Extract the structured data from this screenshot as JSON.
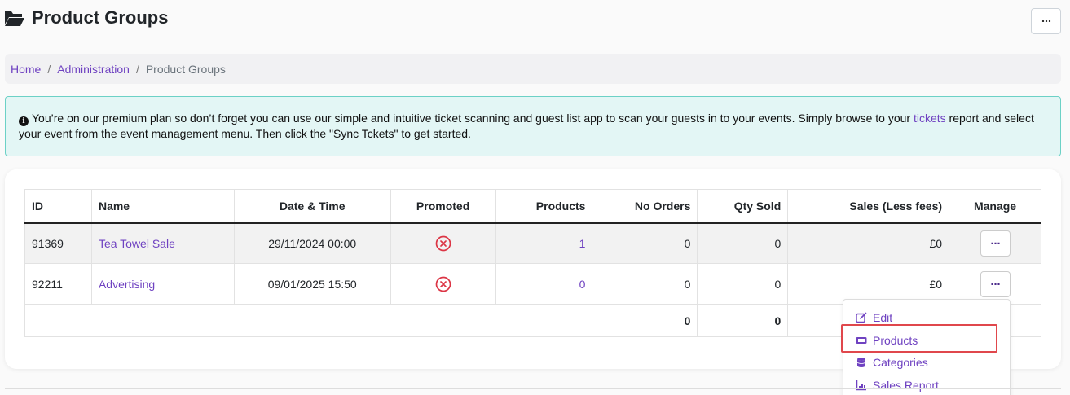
{
  "page": {
    "title": "Product Groups",
    "menu_label": "⋯"
  },
  "breadcrumb": {
    "home": "Home",
    "administration": "Administration",
    "current": "Product Groups",
    "separator": "/"
  },
  "alert": {
    "text_before_link": "You’re on our premium plan so don’t forget you can use our simple and intuitive ticket scanning and guest list app to scan your guests in to your events. Simply browse to your ",
    "link": "tickets",
    "text_after_link": " report and select your event from the event management menu. Then click the \"Sync Tckets\" to get started."
  },
  "table": {
    "headers": {
      "id": "ID",
      "name": "Name",
      "datetime": "Date & Time",
      "promoted": "Promoted",
      "products": "Products",
      "no_orders": "No Orders",
      "qty_sold": "Qty Sold",
      "sales": "Sales (Less fees)",
      "manage": "Manage"
    },
    "rows": [
      {
        "id": "91369",
        "name": "Tea Towel Sale",
        "datetime": "29/11/2024 00:00",
        "products": "1",
        "no_orders": "0",
        "qty_sold": "0",
        "sales": "£0",
        "manage": "⋯"
      },
      {
        "id": "92211",
        "name": "Advertising",
        "datetime": "09/01/2025 15:50",
        "products": "0",
        "no_orders": "0",
        "qty_sold": "0",
        "sales": "£0",
        "manage": "⋯"
      }
    ],
    "totals": {
      "no_orders": "0",
      "qty_sold": "0"
    }
  },
  "dropdown": {
    "items": [
      "Edit",
      "Products",
      "Categories",
      "Sales Report"
    ]
  },
  "colors": {
    "accent": "#6f42c1",
    "alert_bg": "#e3f6f5",
    "alert_border": "#6cd1c6",
    "danger": "#dc3545",
    "highlight": "#e0474c"
  },
  "icons": {
    "title": "folder-open-icon",
    "alert": "info-circle-icon",
    "promoted": "x-circle-icon",
    "edit": "edit-icon",
    "products": "ticket-icon",
    "categories": "database-icon",
    "sales_report": "chart-icon"
  }
}
